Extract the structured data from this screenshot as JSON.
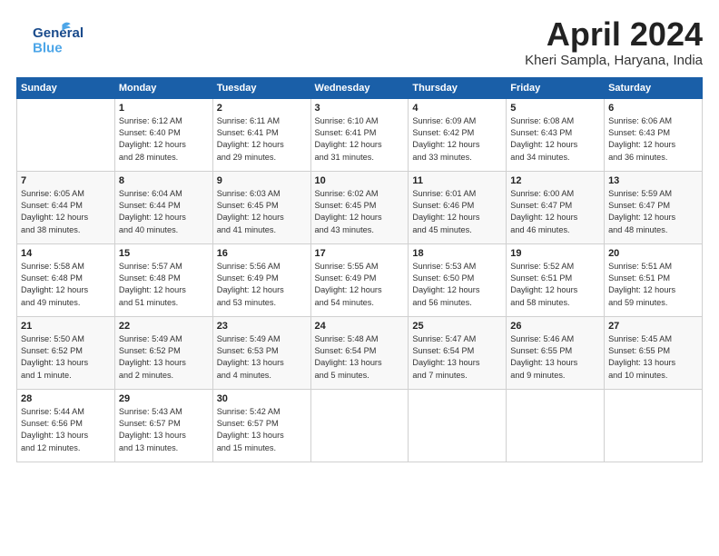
{
  "header": {
    "logo_general": "General",
    "logo_blue": "Blue",
    "title": "April 2024",
    "location": "Kheri Sampla, Haryana, India"
  },
  "days_of_week": [
    "Sunday",
    "Monday",
    "Tuesday",
    "Wednesday",
    "Thursday",
    "Friday",
    "Saturday"
  ],
  "weeks": [
    [
      {
        "day": "",
        "info": ""
      },
      {
        "day": "1",
        "info": "Sunrise: 6:12 AM\nSunset: 6:40 PM\nDaylight: 12 hours\nand 28 minutes."
      },
      {
        "day": "2",
        "info": "Sunrise: 6:11 AM\nSunset: 6:41 PM\nDaylight: 12 hours\nand 29 minutes."
      },
      {
        "day": "3",
        "info": "Sunrise: 6:10 AM\nSunset: 6:41 PM\nDaylight: 12 hours\nand 31 minutes."
      },
      {
        "day": "4",
        "info": "Sunrise: 6:09 AM\nSunset: 6:42 PM\nDaylight: 12 hours\nand 33 minutes."
      },
      {
        "day": "5",
        "info": "Sunrise: 6:08 AM\nSunset: 6:43 PM\nDaylight: 12 hours\nand 34 minutes."
      },
      {
        "day": "6",
        "info": "Sunrise: 6:06 AM\nSunset: 6:43 PM\nDaylight: 12 hours\nand 36 minutes."
      }
    ],
    [
      {
        "day": "7",
        "info": "Sunrise: 6:05 AM\nSunset: 6:44 PM\nDaylight: 12 hours\nand 38 minutes."
      },
      {
        "day": "8",
        "info": "Sunrise: 6:04 AM\nSunset: 6:44 PM\nDaylight: 12 hours\nand 40 minutes."
      },
      {
        "day": "9",
        "info": "Sunrise: 6:03 AM\nSunset: 6:45 PM\nDaylight: 12 hours\nand 41 minutes."
      },
      {
        "day": "10",
        "info": "Sunrise: 6:02 AM\nSunset: 6:45 PM\nDaylight: 12 hours\nand 43 minutes."
      },
      {
        "day": "11",
        "info": "Sunrise: 6:01 AM\nSunset: 6:46 PM\nDaylight: 12 hours\nand 45 minutes."
      },
      {
        "day": "12",
        "info": "Sunrise: 6:00 AM\nSunset: 6:47 PM\nDaylight: 12 hours\nand 46 minutes."
      },
      {
        "day": "13",
        "info": "Sunrise: 5:59 AM\nSunset: 6:47 PM\nDaylight: 12 hours\nand 48 minutes."
      }
    ],
    [
      {
        "day": "14",
        "info": "Sunrise: 5:58 AM\nSunset: 6:48 PM\nDaylight: 12 hours\nand 49 minutes."
      },
      {
        "day": "15",
        "info": "Sunrise: 5:57 AM\nSunset: 6:48 PM\nDaylight: 12 hours\nand 51 minutes."
      },
      {
        "day": "16",
        "info": "Sunrise: 5:56 AM\nSunset: 6:49 PM\nDaylight: 12 hours\nand 53 minutes."
      },
      {
        "day": "17",
        "info": "Sunrise: 5:55 AM\nSunset: 6:49 PM\nDaylight: 12 hours\nand 54 minutes."
      },
      {
        "day": "18",
        "info": "Sunrise: 5:53 AM\nSunset: 6:50 PM\nDaylight: 12 hours\nand 56 minutes."
      },
      {
        "day": "19",
        "info": "Sunrise: 5:52 AM\nSunset: 6:51 PM\nDaylight: 12 hours\nand 58 minutes."
      },
      {
        "day": "20",
        "info": "Sunrise: 5:51 AM\nSunset: 6:51 PM\nDaylight: 12 hours\nand 59 minutes."
      }
    ],
    [
      {
        "day": "21",
        "info": "Sunrise: 5:50 AM\nSunset: 6:52 PM\nDaylight: 13 hours\nand 1 minute."
      },
      {
        "day": "22",
        "info": "Sunrise: 5:49 AM\nSunset: 6:52 PM\nDaylight: 13 hours\nand 2 minutes."
      },
      {
        "day": "23",
        "info": "Sunrise: 5:49 AM\nSunset: 6:53 PM\nDaylight: 13 hours\nand 4 minutes."
      },
      {
        "day": "24",
        "info": "Sunrise: 5:48 AM\nSunset: 6:54 PM\nDaylight: 13 hours\nand 5 minutes."
      },
      {
        "day": "25",
        "info": "Sunrise: 5:47 AM\nSunset: 6:54 PM\nDaylight: 13 hours\nand 7 minutes."
      },
      {
        "day": "26",
        "info": "Sunrise: 5:46 AM\nSunset: 6:55 PM\nDaylight: 13 hours\nand 9 minutes."
      },
      {
        "day": "27",
        "info": "Sunrise: 5:45 AM\nSunset: 6:55 PM\nDaylight: 13 hours\nand 10 minutes."
      }
    ],
    [
      {
        "day": "28",
        "info": "Sunrise: 5:44 AM\nSunset: 6:56 PM\nDaylight: 13 hours\nand 12 minutes."
      },
      {
        "day": "29",
        "info": "Sunrise: 5:43 AM\nSunset: 6:57 PM\nDaylight: 13 hours\nand 13 minutes."
      },
      {
        "day": "30",
        "info": "Sunrise: 5:42 AM\nSunset: 6:57 PM\nDaylight: 13 hours\nand 15 minutes."
      },
      {
        "day": "",
        "info": ""
      },
      {
        "day": "",
        "info": ""
      },
      {
        "day": "",
        "info": ""
      },
      {
        "day": "",
        "info": ""
      }
    ]
  ]
}
